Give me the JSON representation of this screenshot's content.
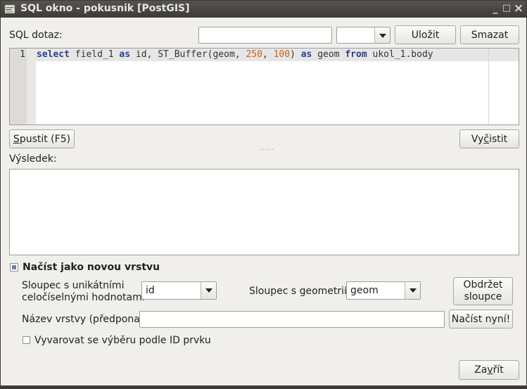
{
  "window": {
    "title": "SQL okno - pokusnik [PostGIS]",
    "controls": {
      "minimize": "_",
      "maximize": "□",
      "close": "×"
    }
  },
  "sql": {
    "label": "SQL dotaz:",
    "query_name_value": "",
    "saved_queries_value": "",
    "save_label": "Uložit",
    "delete_label": "Smazat"
  },
  "editor": {
    "line_number": "1",
    "tokens": [
      {
        "t": "select",
        "k": "kw"
      },
      {
        "t": " field_1 ",
        "k": "id"
      },
      {
        "t": "as",
        "k": "kw"
      },
      {
        "t": " id, ST_Buffer(geom, ",
        "k": "id"
      },
      {
        "t": "250",
        "k": "num"
      },
      {
        "t": ", ",
        "k": "id"
      },
      {
        "t": "100",
        "k": "num"
      },
      {
        "t": ") ",
        "k": "id"
      },
      {
        "t": "as",
        "k": "kw"
      },
      {
        "t": " geom ",
        "k": "id"
      },
      {
        "t": "from",
        "k": "kw"
      },
      {
        "t": " ukol_1.body",
        "k": "id"
      }
    ]
  },
  "actions": {
    "run_label": "Spustit (F5)",
    "clear_label": "Vyčistit",
    "splitter": "....."
  },
  "result": {
    "label": "Výsledek:"
  },
  "layer": {
    "load_as_layer_label": "Načíst jako novou vrstvu",
    "load_as_layer_checked": true,
    "unique_column_label_1": "Sloupec s unikátními",
    "unique_column_label_2": "celočíselnými hodnotami",
    "unique_column_value": "id",
    "geometry_column_label": "Sloupec s geometrií",
    "geometry_column_value": "geom",
    "get_columns_label_1": "Obdržet",
    "get_columns_label_2": "sloupce",
    "layer_name_label": "Název vrstvy (předpona)",
    "layer_name_value": "",
    "load_now_label": "Načíst nyní!",
    "avoid_select_label": "Vyvarovat se výběru podle ID prvku",
    "avoid_select_checked": false
  },
  "footer": {
    "close_label": "Zavřít"
  }
}
